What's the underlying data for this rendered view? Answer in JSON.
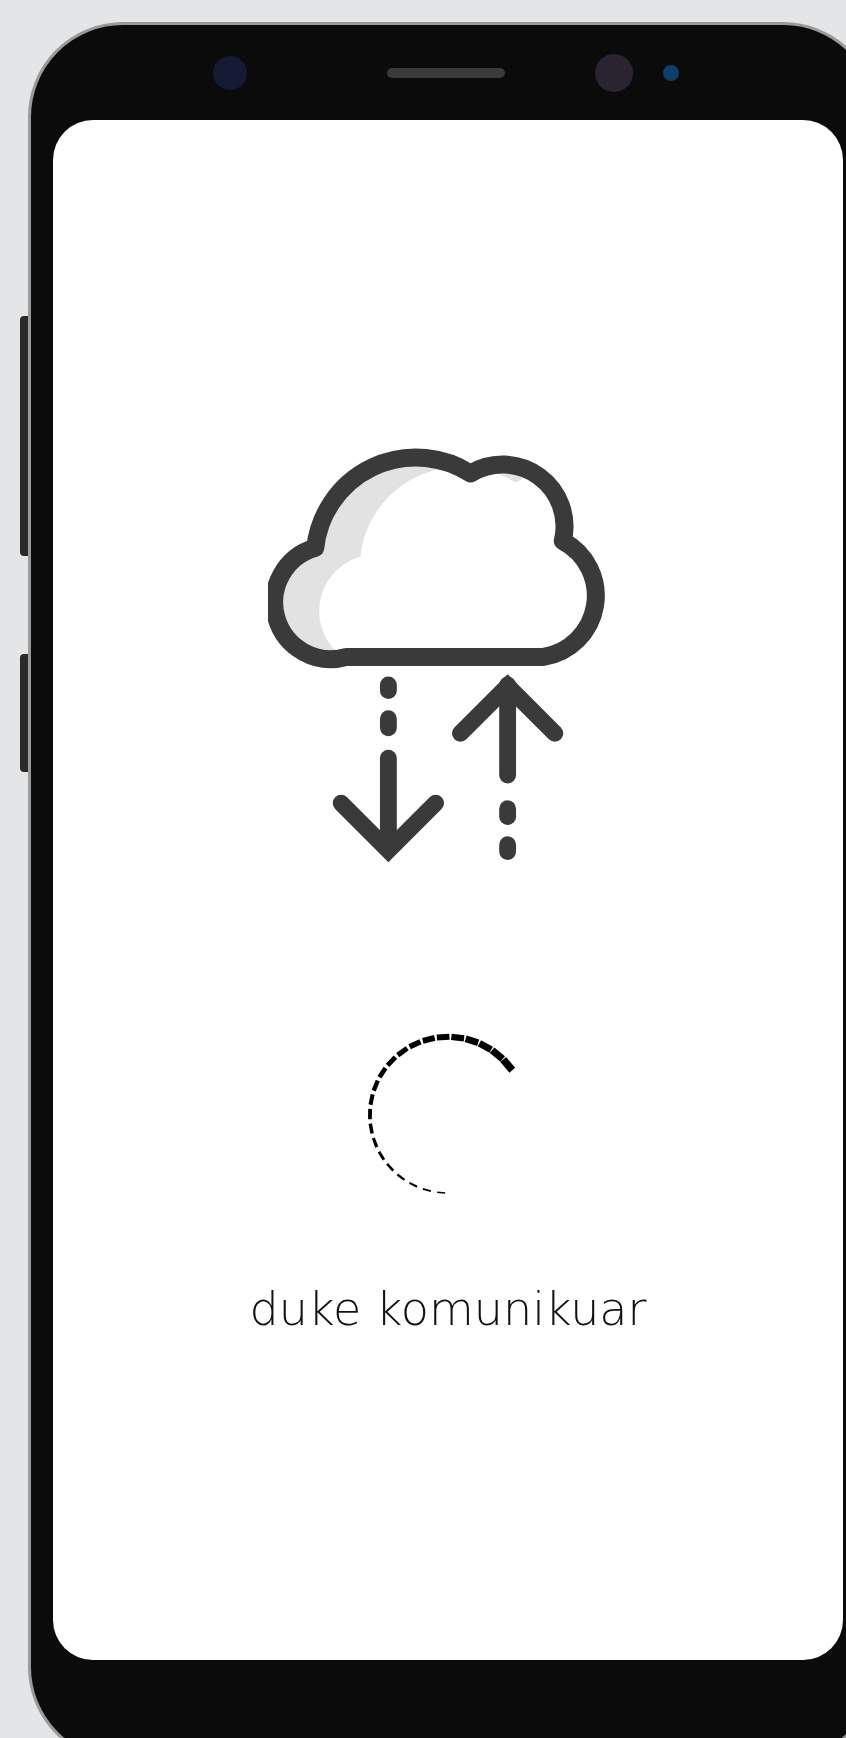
{
  "status_text": "duke komunikuar"
}
